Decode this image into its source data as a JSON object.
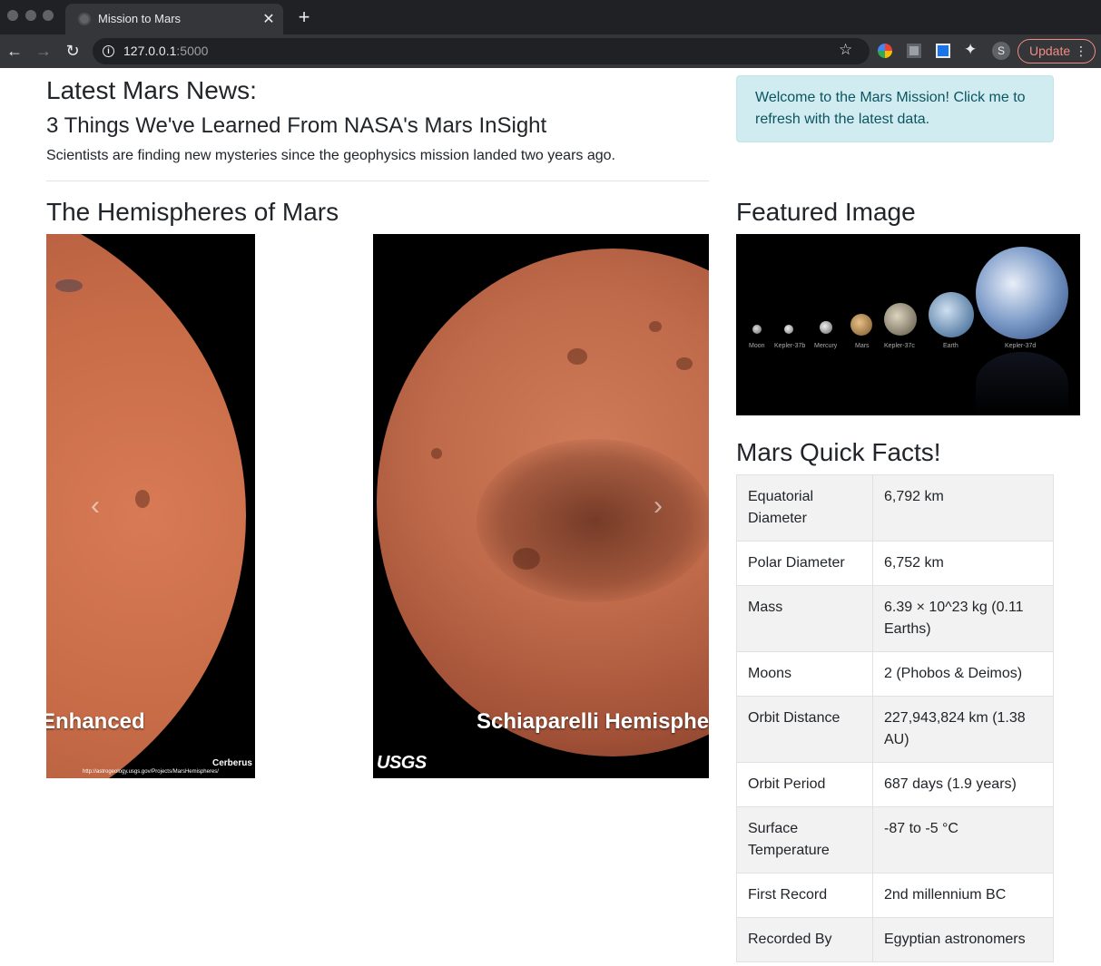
{
  "browser": {
    "tab_title": "Mission to Mars",
    "url_host": "127.0.0.1",
    "url_port": ":5000",
    "avatar_letter": "S",
    "update_label": "Update"
  },
  "news": {
    "heading": "Latest Mars News:",
    "title": "3 Things We've Learned From NASA's Mars InSight",
    "teaser": "Scientists are finding new mysteries since the geophysics mission landed two years ago."
  },
  "alert": {
    "text": "Welcome to the Mars Mission! Click me to refresh with the latest data."
  },
  "hemispheres": {
    "heading": "The Hemispheres of Mars",
    "slides": [
      {
        "caption": "Enhanced",
        "credit": "Cerberus",
        "credit_url": "http://astrogeology.usgs.gov/Projects/MarsHemispheres/"
      },
      {
        "caption": "Schiaparelli Hemisphere",
        "logo_text": "USGS"
      }
    ],
    "prev_glyph": "‹",
    "next_glyph": "›"
  },
  "featured": {
    "heading": "Featured Image",
    "labels": [
      "Moon",
      "Kepler-37b",
      "Mercury",
      "Mars",
      "Kepler-37c",
      "Earth",
      "Kepler-37d"
    ]
  },
  "facts": {
    "heading": "Mars Quick Facts!",
    "rows": [
      [
        "Equatorial Diameter",
        "6,792 km"
      ],
      [
        "Polar Diameter",
        "6,752 km"
      ],
      [
        "Mass",
        "6.39 × 10^23 kg (0.11 Earths)"
      ],
      [
        "Moons",
        "2 (Phobos & Deimos)"
      ],
      [
        "Orbit Distance",
        "227,943,824 km (1.38 AU)"
      ],
      [
        "Orbit Period",
        "687 days (1.9 years)"
      ],
      [
        "Surface Temperature",
        "-87 to -5 °C"
      ],
      [
        "First Record",
        "2nd millennium BC"
      ],
      [
        "Recorded By",
        "Egyptian astronomers"
      ]
    ]
  }
}
